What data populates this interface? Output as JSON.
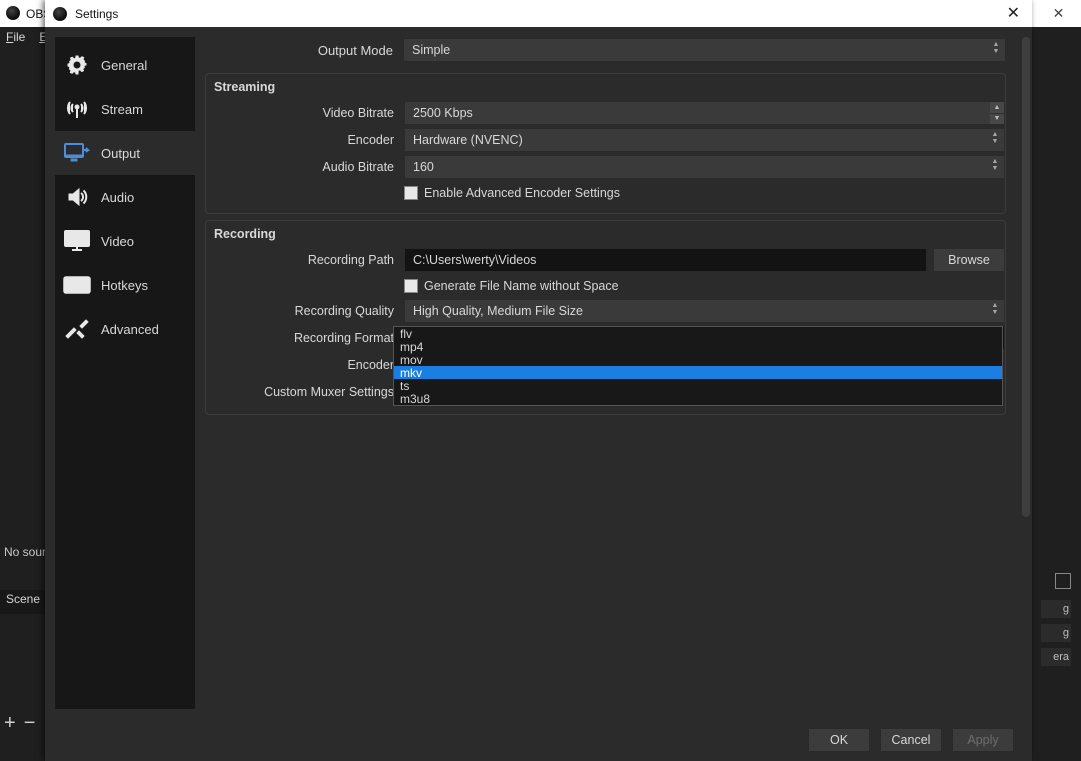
{
  "bg": {
    "app_title": "OBS",
    "menu": {
      "file": "File",
      "edit": "E"
    },
    "no_sources": "No sourc",
    "scene_hdr": "Scene",
    "right_items": [
      "g",
      "g",
      "era"
    ]
  },
  "dlg": {
    "title": "Settings",
    "sidebar": [
      {
        "id": "general",
        "label": "General"
      },
      {
        "id": "stream",
        "label": "Stream"
      },
      {
        "id": "output",
        "label": "Output"
      },
      {
        "id": "audio",
        "label": "Audio"
      },
      {
        "id": "video",
        "label": "Video"
      },
      {
        "id": "hotkeys",
        "label": "Hotkeys"
      },
      {
        "id": "advanced",
        "label": "Advanced"
      }
    ],
    "active_sidebar_idx": 2,
    "output_mode": {
      "label": "Output Mode",
      "value": "Simple"
    },
    "streaming": {
      "title": "Streaming",
      "video_bitrate": {
        "label": "Video Bitrate",
        "value": "2500 Kbps"
      },
      "encoder": {
        "label": "Encoder",
        "value": "Hardware (NVENC)"
      },
      "audio_bitrate": {
        "label": "Audio Bitrate",
        "value": "160"
      },
      "enable_adv": {
        "label": "Enable Advanced Encoder Settings"
      }
    },
    "recording": {
      "title": "Recording",
      "path": {
        "label": "Recording Path",
        "value": "C:\\Users\\werty\\Videos"
      },
      "browse": "Browse",
      "gen_name": {
        "label": "Generate File Name without Space"
      },
      "quality": {
        "label": "Recording Quality",
        "value": "High Quality, Medium File Size"
      },
      "format": {
        "label": "Recording Format",
        "value": "mkv",
        "options": [
          "flv",
          "mp4",
          "mov",
          "mkv",
          "ts",
          "m3u8"
        ],
        "selected_idx": 3
      },
      "encoder": {
        "label": "Encoder"
      },
      "muxer": {
        "label": "Custom Muxer Settings"
      }
    },
    "footer": {
      "ok": "OK",
      "cancel": "Cancel",
      "apply": "Apply"
    }
  }
}
